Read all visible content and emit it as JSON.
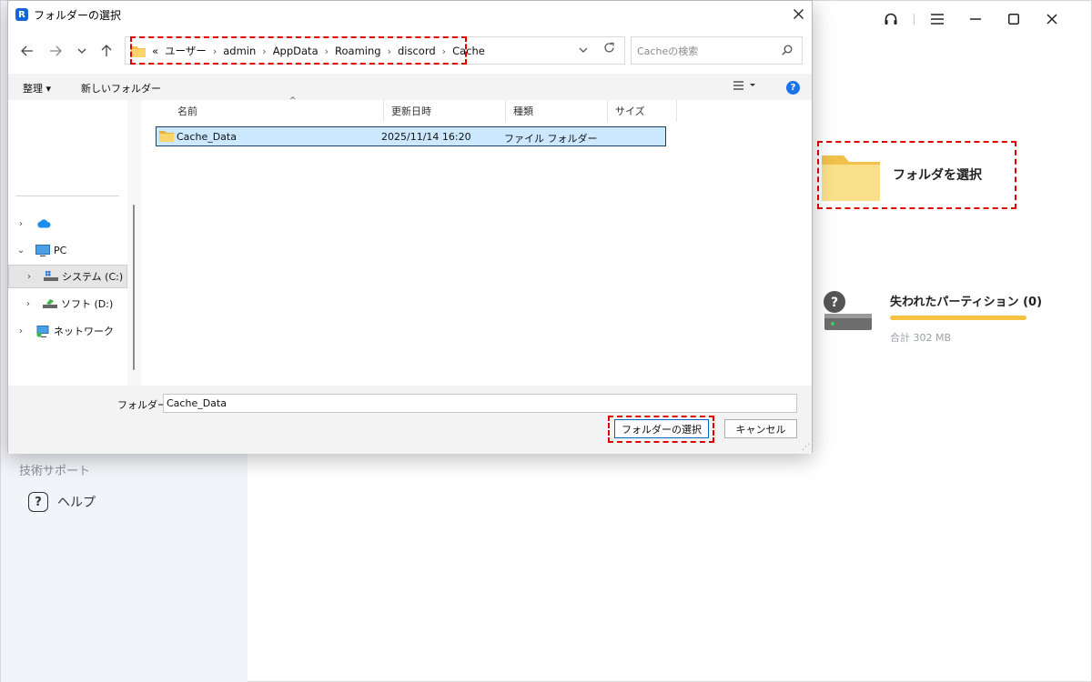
{
  "app": {
    "sidebar": {
      "section_label": "技術サポート",
      "help_label": "ヘルプ"
    },
    "select_folder_label": "フォルダを選択",
    "partition": {
      "title": "失われたパーティション (0)",
      "size": "合計 302 MB",
      "bar_color": "#f6c343"
    },
    "top_icons": [
      "headset-icon",
      "menu-icon",
      "minimize-icon",
      "maximize-icon",
      "close-icon"
    ]
  },
  "dialog": {
    "title": "フォルダーの選択",
    "address": {
      "prefix": "«",
      "crumbs": [
        "ユーザー",
        "admin",
        "AppData",
        "Roaming",
        "discord",
        "Cache"
      ]
    },
    "search_placeholder": "Cacheの検索",
    "cmd": {
      "organize": "整理 ▾",
      "new_folder": "新しいフォルダー"
    },
    "tree": {
      "onedrive": "",
      "pc": "PC",
      "system": "システム (C:)",
      "soft": "ソフト (D:)",
      "network": "ネットワーク"
    },
    "columns": {
      "name": "名前",
      "date": "更新日時",
      "type": "種類",
      "size": "サイズ"
    },
    "files": [
      {
        "name": "Cache_Data",
        "date": "2025/11/14 16:20",
        "type": "ファイル フォルダー",
        "size": ""
      }
    ],
    "folder_field_label": "フォルダー:",
    "folder_field_value": "Cache_Data",
    "select_button": "フォルダーの選択",
    "cancel_button": "キャンセル",
    "accent_color": "#0067c0",
    "highlight_color": "#e00000"
  }
}
